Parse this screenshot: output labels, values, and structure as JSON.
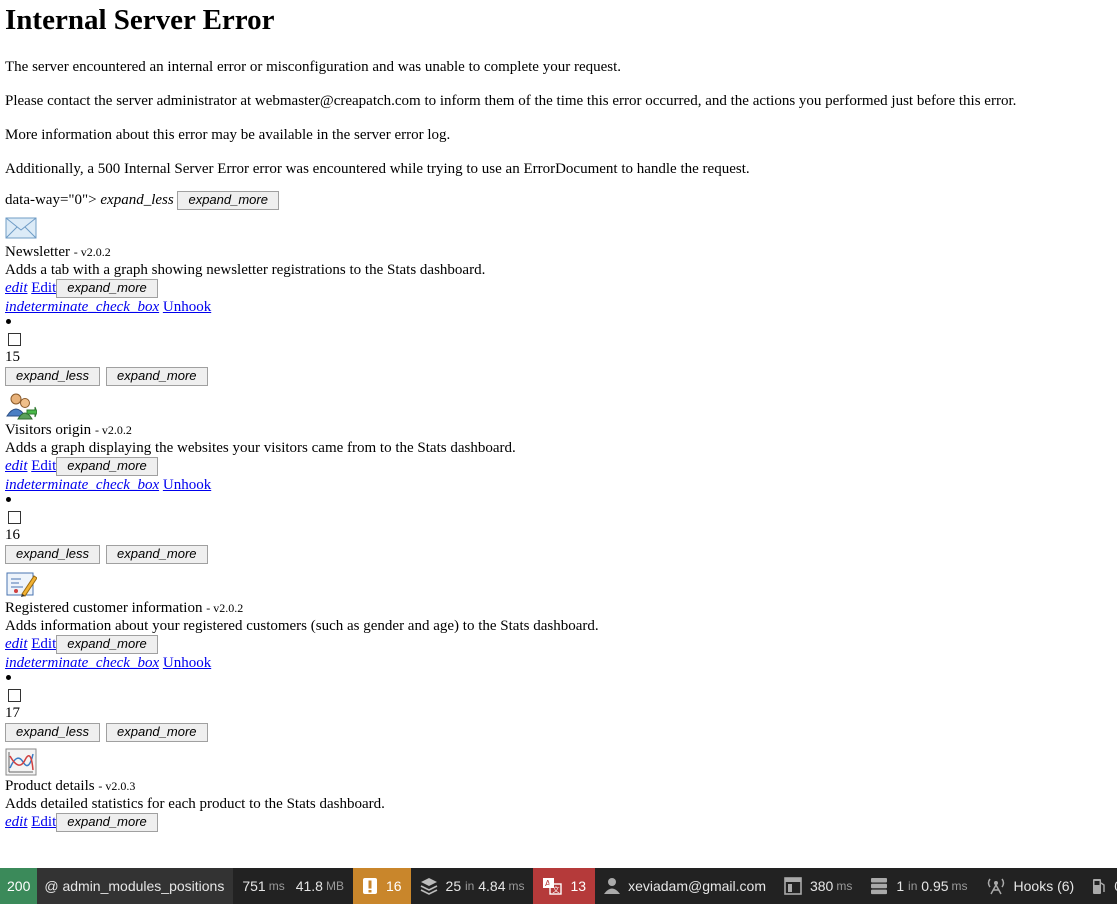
{
  "error": {
    "title": "Internal Server Error",
    "p1": "The server encountered an internal error or misconfiguration and was unable to complete your request.",
    "p2": "Please contact the server administrator at webmaster@creapatch.com to inform them of the time this error occurred, and the actions you performed just before this error.",
    "p3": "More information about this error may be available in the server error log.",
    "p4": "Additionally, a 500 Internal Server Error error was encountered while trying to use an ErrorDocument to handle the request."
  },
  "fragment": {
    "prefix": "data-way=\"0\"> ",
    "expand_less": "expand_less",
    "expand_more": "expand_more"
  },
  "common": {
    "edit_icon": "edit",
    "edit_label": "Edit",
    "unhook_icon": "indeterminate_check_box",
    "unhook_label": "Unhook",
    "expand_less": "expand_less",
    "expand_more": "expand_more"
  },
  "modules": [
    {
      "icon": "envelope-icon",
      "name": "Newsletter",
      "version": "- v2.0.2",
      "description": "Adds a tab with a graph showing newsletter registrations to the Stats dashboard.",
      "position": "15"
    },
    {
      "icon": "visitors-icon",
      "name": "Visitors origin",
      "version": "- v2.0.2",
      "description": "Adds a graph displaying the websites your visitors came from to the Stats dashboard.",
      "position": "16"
    },
    {
      "icon": "customer-info-icon",
      "name": "Registered customer information",
      "version": "- v2.0.2",
      "description": "Adds information about your registered customers (such as gender and age) to the Stats dashboard.",
      "position": "17"
    },
    {
      "icon": "product-graph-icon",
      "name": "Product details",
      "version": "- v2.0.3",
      "description": "Adds detailed statistics for each product to the Stats dashboard."
    }
  ],
  "toolbar": {
    "status": "200",
    "route": "@ admin_modules_positions",
    "time": "751",
    "time_unit": "ms",
    "memory": "41.8",
    "memory_unit": "MB",
    "warnings": "16",
    "queries": "25",
    "queries_in": "in",
    "queries_time": "4.84",
    "queries_unit": "ms",
    "translations": "13",
    "user": "xeviadam@gmail.com",
    "render_time": "380",
    "render_unit": "ms",
    "cache": "1",
    "cache_in": "in",
    "cache_time": "0.95",
    "cache_unit": "ms",
    "hooks": "Hooks (6)",
    "last": "0",
    "colors": {
      "status": "#3b8a5a",
      "warn": "#c9862b",
      "red": "#b53a3a",
      "bar": "#222222"
    }
  }
}
